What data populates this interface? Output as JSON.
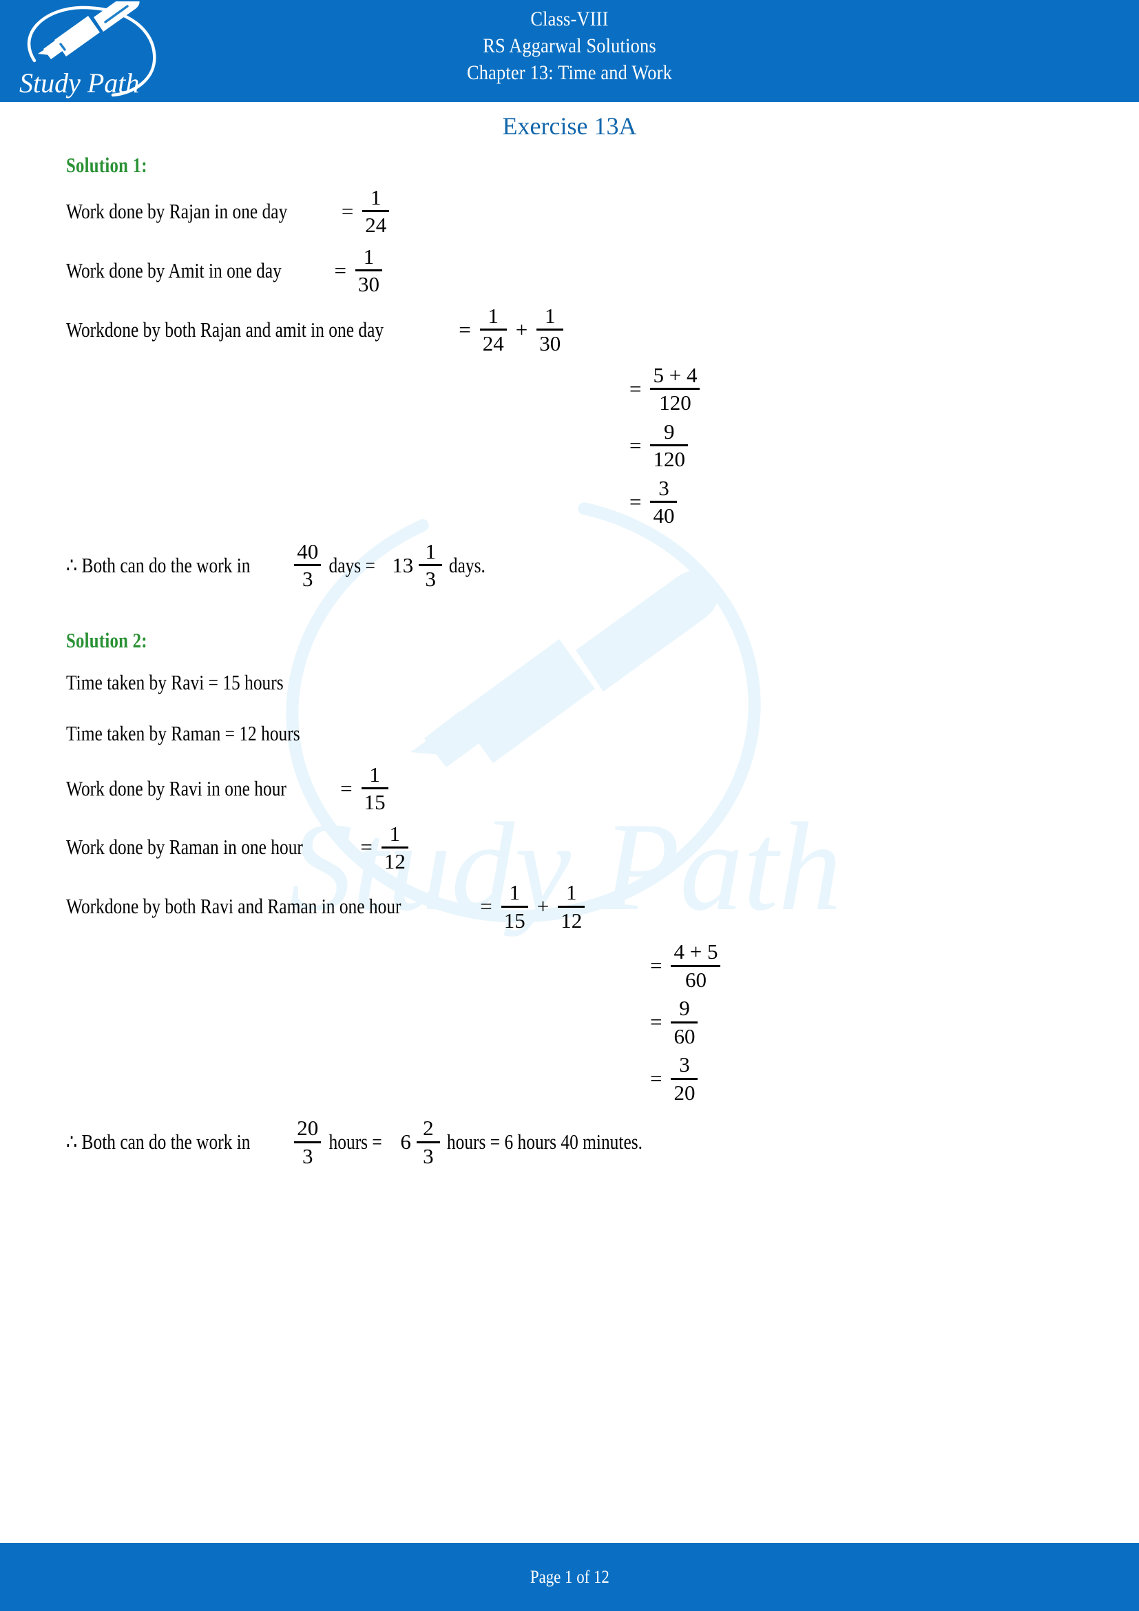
{
  "header": {
    "logo_alt": "Study Path",
    "logo_text": "Study Path",
    "line1": "Class-VIII",
    "line2": "RS Aggarwal Solutions",
    "line3": "Chapter 13: Time and Work",
    "bg_color": "#0a6fc2"
  },
  "watermark": {
    "text": "Study Path",
    "color": "#e8f5fc"
  },
  "page": {
    "exercise_title": "Exercise 13A",
    "exercise_title_color": "#1266ab",
    "solution_heading_color": "#2a9134"
  },
  "solutions": [
    {
      "heading": "Solution 1:",
      "lines": [
        {
          "label": "Work done by Rajan in one day",
          "eq": "=",
          "frac": {
            "num": "1",
            "den": "24"
          }
        },
        {
          "label": "Work done by Amit in one day",
          "eq": "=",
          "frac": {
            "num": "1",
            "den": "30"
          }
        },
        {
          "label": "Workdone by both Rajan and amit in one day",
          "eq": "=",
          "frac": {
            "num": "1",
            "den": "24"
          },
          "op": "+",
          "frac2": {
            "num": "1",
            "den": "30"
          }
        }
      ],
      "continuations": [
        {
          "eq": "=",
          "num": "5 + 4",
          "den": "120"
        },
        {
          "eq": "=",
          "num": "9",
          "den": "120"
        },
        {
          "eq": "=",
          "num": "3",
          "den": "40"
        }
      ],
      "conclusion": {
        "prefix": "∴ Both can do the work in",
        "frac": {
          "num": "40",
          "den": "3"
        },
        "middle": "days =",
        "mixed": {
          "whole": "13",
          "num": "1",
          "den": "3"
        },
        "suffix": "days."
      }
    },
    {
      "heading": "Solution 2:",
      "plain_lines": [
        "Time taken by Ravi = 15 hours",
        "Time taken by Raman = 12 hours"
      ],
      "lines": [
        {
          "label": "Work done by Ravi in one hour",
          "eq": "=",
          "frac": {
            "num": "1",
            "den": "15"
          }
        },
        {
          "label": "Work done by Raman in one hour",
          "eq": "=",
          "frac": {
            "num": "1",
            "den": "12"
          }
        },
        {
          "label": "Workdone by both Ravi and Raman in one hour",
          "eq": "=",
          "frac": {
            "num": "1",
            "den": "15"
          },
          "op": "+",
          "frac2": {
            "num": "1",
            "den": "12"
          }
        }
      ],
      "continuations": [
        {
          "eq": "=",
          "num": "4 + 5",
          "den": "60"
        },
        {
          "eq": "=",
          "num": "9",
          "den": "60"
        },
        {
          "eq": "=",
          "num": "3",
          "den": "20"
        }
      ],
      "conclusion": {
        "prefix": "∴ Both can do the work in",
        "frac": {
          "num": "20",
          "den": "3"
        },
        "middle": "hours =",
        "mixed": {
          "whole": "6",
          "num": "2",
          "den": "3"
        },
        "suffix": "hours = 6 hours 40 minutes."
      }
    }
  ],
  "footer": {
    "text": "Page 1 of 12",
    "bg_color": "#0a6fc2"
  }
}
